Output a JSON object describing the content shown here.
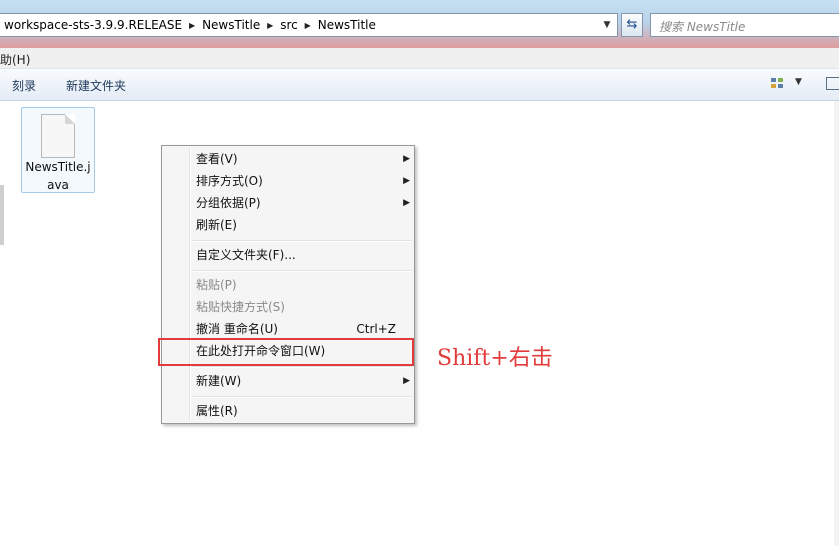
{
  "address_bar": {
    "crumbs": [
      "workspace-sts-3.9.9.RELEASE",
      "NewsTitle",
      "src",
      "NewsTitle"
    ],
    "search_placeholder": "搜索 NewsTitle"
  },
  "menubar": {
    "partial_item": "助(H)"
  },
  "toolbar": {
    "burn": "刻录",
    "new_folder": "新建文件夹"
  },
  "files": [
    {
      "name": "NewsTitle.java",
      "name_line1": "NewsTitle.j",
      "name_line2": "ava"
    }
  ],
  "context_menu": {
    "items": [
      {
        "label": "查看(V)",
        "submenu": true
      },
      {
        "label": "排序方式(O)",
        "submenu": true
      },
      {
        "label": "分组依据(P)",
        "submenu": true
      },
      {
        "label": "刷新(E)"
      },
      {
        "label": "自定义文件夹(F)..."
      },
      {
        "label": "粘贴(P)",
        "disabled": true
      },
      {
        "label": "粘贴快捷方式(S)",
        "disabled": true
      },
      {
        "label": "撤消 重命名(U)",
        "shortcut": "Ctrl+Z"
      },
      {
        "label": "在此处打开命令窗口(W)"
      },
      {
        "label": "新建(W)",
        "submenu": true
      },
      {
        "label": "属性(R)"
      }
    ]
  },
  "annotation": {
    "text": "Shift+右击",
    "color": "#e23b3b"
  }
}
